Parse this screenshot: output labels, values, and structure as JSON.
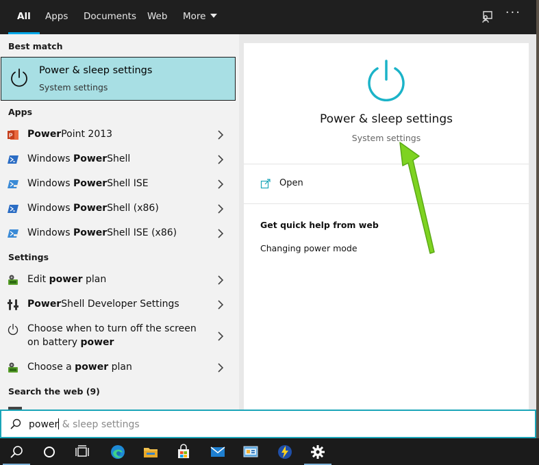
{
  "topbar": {
    "tabs": [
      {
        "label": "All",
        "active": true
      },
      {
        "label": "Apps"
      },
      {
        "label": "Documents"
      },
      {
        "label": "Web"
      },
      {
        "label": "More"
      }
    ],
    "feedback_icon": "feedback-icon",
    "more_options_icon": "ellipsis-icon"
  },
  "left": {
    "best_match_header": "Best match",
    "best_match": {
      "title": "Power & sleep settings",
      "subtitle": "System settings",
      "icon": "power-icon"
    },
    "apps_header": "Apps",
    "apps": [
      {
        "pre": "",
        "bold": "Power",
        "post": "Point 2013",
        "icon": "powerpoint-icon"
      },
      {
        "pre": "Windows ",
        "bold": "Power",
        "post": "Shell",
        "icon": "powershell-icon"
      },
      {
        "pre": "Windows ",
        "bold": "Power",
        "post": "Shell ISE",
        "icon": "powershell-ise-icon"
      },
      {
        "pre": "Windows ",
        "bold": "Power",
        "post": "Shell (x86)",
        "icon": "powershell-icon"
      },
      {
        "pre": "Windows ",
        "bold": "Power",
        "post": "Shell ISE (x86)",
        "icon": "powershell-ise-icon"
      }
    ],
    "settings_header": "Settings",
    "settings": [
      {
        "pre": "Edit ",
        "bold": "power",
        "post": " plan",
        "icon": "power-plan-icon"
      },
      {
        "pre": "",
        "bold": "Power",
        "post": "Shell Developer Settings",
        "icon": "developer-settings-icon"
      },
      {
        "pre": "Choose when to turn off the screen on battery ",
        "bold": "power",
        "post": "",
        "icon": "power-icon"
      },
      {
        "pre": "Choose a ",
        "bold": "power",
        "post": " plan",
        "icon": "power-plan-icon"
      }
    ],
    "web_header": "Search the web (9)"
  },
  "details": {
    "title": "Power & sleep settings",
    "subtitle": "System settings",
    "open_label": "Open",
    "quick_help_header": "Get quick help from web",
    "quick_help_link": "Changing power mode"
  },
  "search": {
    "typed": "power",
    "suggestion": " & sleep settings"
  },
  "taskbar": {
    "items": [
      "search-icon",
      "cortana-icon",
      "task-view-icon",
      "edge-icon",
      "file-explorer-icon",
      "store-icon",
      "mail-icon",
      "control-panel-icon",
      "winaero-icon",
      "settings-icon"
    ]
  },
  "colors": {
    "accent": "#00a8e8",
    "best_match_bg": "#a8dfe4",
    "power_icon": "#1bb3c8",
    "search_border": "#1aa5b8",
    "arrow": "#7ed321"
  }
}
